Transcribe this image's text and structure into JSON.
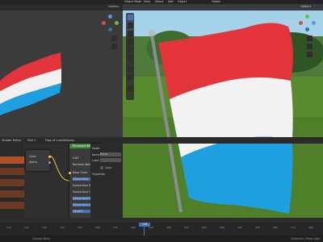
{
  "topbar": {
    "menu_left": "Object Mode",
    "menu_view": "View",
    "menu_select": "Select",
    "menu_add": "Add",
    "menu_object": "Object",
    "transform": "Global"
  },
  "viewport_left": {
    "options_label": "Options"
  },
  "viewport_right": {
    "options_label": "Options"
  },
  "node_editor": {
    "header_object": "Shader Editor",
    "slot": "Slot 1",
    "material": "Flag of Luxembourg",
    "node_title": "Principled BSDF",
    "rows": [
      "GGX",
      "Random Walk",
      "Base Color",
      "Subsurface",
      "Subsurface Radius",
      "Subsurface Co...",
      "Subsurface IOR",
      "Subsurface Anisotropy",
      "Metallic"
    ],
    "left_rows": [
      "Color",
      "Alpha"
    ],
    "sidebar_title": "Node",
    "sidebar_name_label": "Name",
    "sidebar_name_value": "Bump",
    "sidebar_label_label": "Label",
    "sidebar_color_label": "Color",
    "sidebar_properties": "Properties"
  },
  "timeline": {
    "ticks": [
      "110",
      "120",
      "130",
      "140",
      "150",
      "160",
      "170",
      "180",
      "190",
      "200",
      "210",
      "220",
      "230",
      "240",
      "250",
      "260",
      "270",
      "280"
    ],
    "current_frame": "169"
  },
  "statusbar": {
    "left": "Context Menu",
    "right": "Collection | Plane Light"
  },
  "colors": {
    "flag_red": "#e4343b",
    "flag_white": "#f2f2f2",
    "flag_blue": "#1d9fe0",
    "accent": "#4772b3"
  }
}
